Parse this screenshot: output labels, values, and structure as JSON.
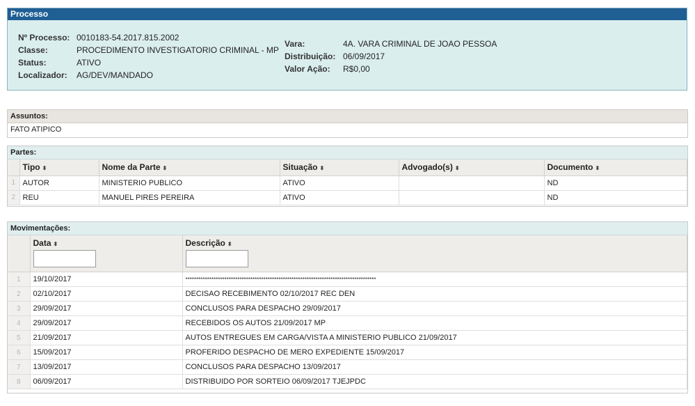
{
  "processo": {
    "header": "Processo",
    "left": [
      {
        "label": "Nº Processo:",
        "value": "0010183-54.2017.815.2002"
      },
      {
        "label": "Classe:",
        "value": "PROCEDIMENTO INVESTIGATORIO CRIMINAL - MP"
      },
      {
        "label": "Status:",
        "value": "ATIVO"
      },
      {
        "label": "Localizador:",
        "value": "AG/DEV/MANDADO"
      }
    ],
    "right": [
      {
        "label": "Vara:",
        "value": "4A. VARA CRIMINAL DE JOAO PESSOA"
      },
      {
        "label": "Distribuição:",
        "value": "06/09/2017"
      },
      {
        "label": "Valor Ação:",
        "value": "R$0,00"
      }
    ]
  },
  "assuntos": {
    "header": "Assuntos:",
    "value": "FATO ATIPICO"
  },
  "partes": {
    "header": "Partes:",
    "columns": [
      "Tipo",
      "Nome da Parte",
      "Situação",
      "Advogado(s)",
      "Documento"
    ],
    "rows": [
      {
        "n": "1",
        "tipo": "AUTOR",
        "nome": "MINISTERIO PUBLICO",
        "situacao": "ATIVO",
        "advogado": "",
        "documento": "ND"
      },
      {
        "n": "2",
        "tipo": "REU",
        "nome": "MANUEL PIRES PEREIRA",
        "situacao": "ATIVO",
        "advogado": "",
        "documento": "ND"
      }
    ]
  },
  "movimentacoes": {
    "header": "Movimentações:",
    "columns": [
      "Data",
      "Descrição"
    ],
    "filters": {
      "data": "",
      "descricao": ""
    },
    "rows": [
      {
        "n": "1",
        "data": "19/10/2017",
        "descricao": "****************************************************************************************"
      },
      {
        "n": "2",
        "data": "02/10/2017",
        "descricao": "DECISAO RECEBIMENTO 02/10/2017 REC DEN"
      },
      {
        "n": "3",
        "data": "29/09/2017",
        "descricao": "CONCLUSOS PARA DESPACHO 29/09/2017"
      },
      {
        "n": "4",
        "data": "29/09/2017",
        "descricao": "RECEBIDOS OS AUTOS 21/09/2017 MP"
      },
      {
        "n": "5",
        "data": "21/09/2017",
        "descricao": "AUTOS ENTREGUES EM CARGA/VISTA A MINISTERIO PUBLICO 21/09/2017"
      },
      {
        "n": "6",
        "data": "15/09/2017",
        "descricao": "PROFERIDO DESPACHO DE MERO EXPEDIENTE 15/09/2017"
      },
      {
        "n": "7",
        "data": "13/09/2017",
        "descricao": "CONCLUSOS PARA DESPACHO 13/09/2017"
      },
      {
        "n": "8",
        "data": "06/09/2017",
        "descricao": "DISTRIBUIDO POR SORTEIO 06/09/2017 TJEJPDC"
      }
    ]
  },
  "icons": {
    "sort": "sort-arrows-icon",
    "sort_glyph": "⬍"
  }
}
